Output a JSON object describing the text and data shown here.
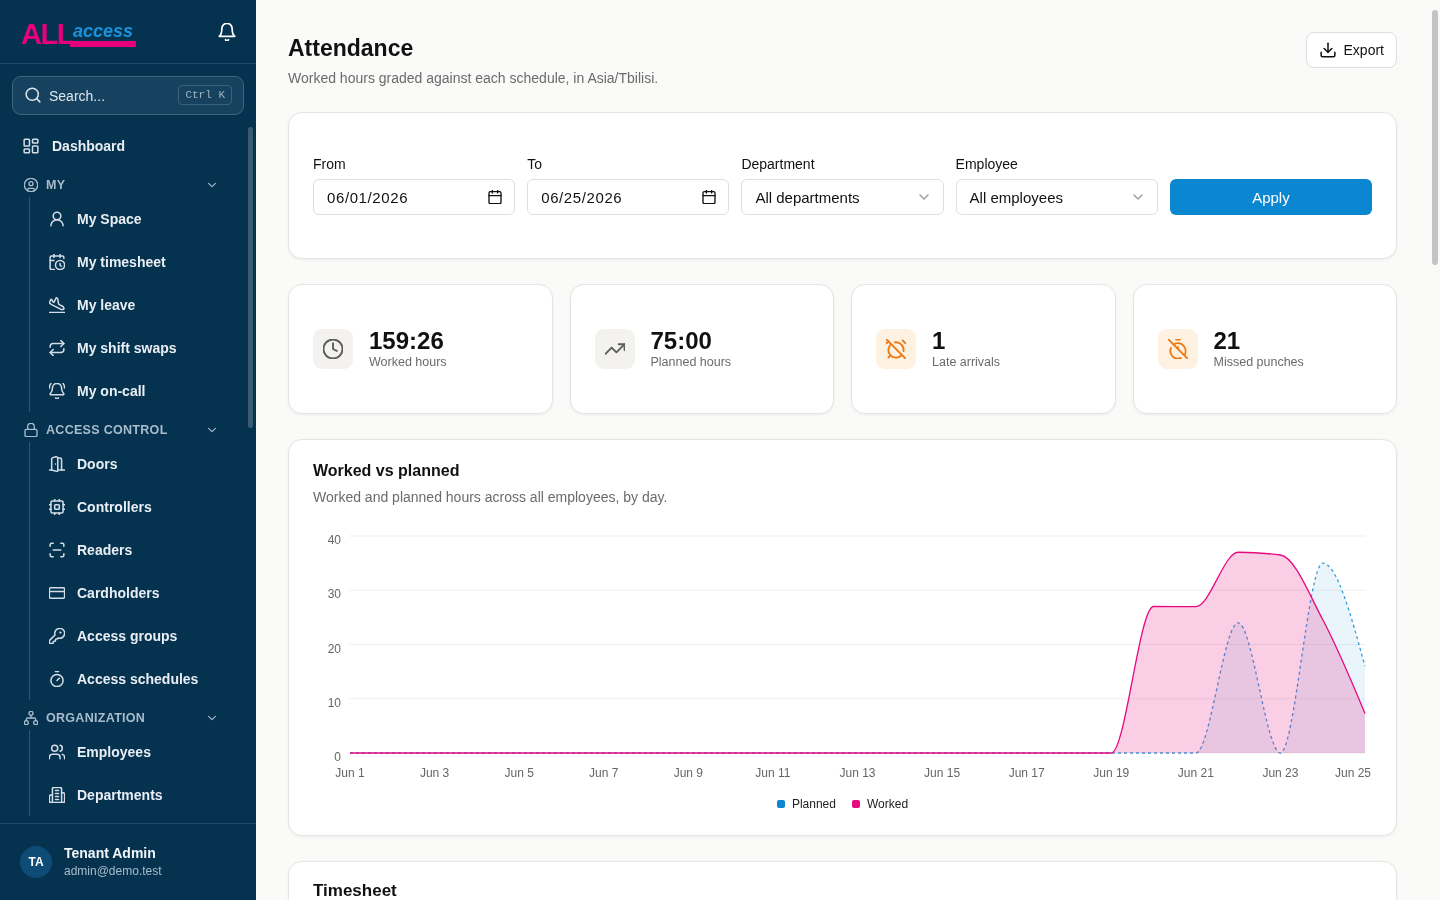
{
  "sidebar": {
    "logo": {
      "mark": "ALL",
      "word": "access"
    },
    "search": {
      "placeholder": "Search...",
      "shortcut": "Ctrl K"
    },
    "items": [
      {
        "kind": "link",
        "label": "Dashboard",
        "selected": false
      },
      {
        "kind": "section",
        "label": "MY",
        "expanded": true,
        "children": [
          {
            "label": "My Space",
            "selected": false
          },
          {
            "label": "My timesheet",
            "selected": false
          },
          {
            "label": "My leave",
            "selected": false
          },
          {
            "label": "My shift swaps",
            "selected": false
          },
          {
            "label": "My on-call",
            "selected": false
          }
        ]
      },
      {
        "kind": "section",
        "label": "ACCESS CONTROL",
        "expanded": true,
        "children": [
          {
            "label": "Doors",
            "selected": false
          },
          {
            "label": "Controllers",
            "selected": false
          },
          {
            "label": "Readers",
            "selected": false
          },
          {
            "label": "Cardholders",
            "selected": false
          },
          {
            "label": "Access groups",
            "selected": false
          },
          {
            "label": "Access schedules",
            "selected": false
          }
        ]
      },
      {
        "kind": "section",
        "label": "ORGANIZATION",
        "expanded": true,
        "children": [
          {
            "label": "Employees",
            "selected": false
          },
          {
            "label": "Departments",
            "selected": false
          }
        ]
      }
    ],
    "user": {
      "initials": "TA",
      "name": "Tenant Admin",
      "email": "admin@demo.test"
    }
  },
  "page": {
    "title": "Attendance",
    "subtitle": "Worked hours graded against each schedule, in Asia/Tbilisi.",
    "export_button": "Export"
  },
  "filters": {
    "fields": [
      {
        "kind": "date",
        "label": "From",
        "value": "06/01/2026"
      },
      {
        "kind": "date",
        "label": "To",
        "value": "06/25/2026"
      },
      {
        "kind": "select",
        "label": "Department",
        "value": "All departments"
      },
      {
        "kind": "select",
        "label": "Employee",
        "value": "All employees"
      }
    ],
    "apply_button": "Apply"
  },
  "stats": [
    {
      "value": "159:26",
      "label": "Worked hours",
      "warning": false
    },
    {
      "value": "75:00",
      "label": "Planned hours",
      "warning": false
    },
    {
      "value": "1",
      "label": "Late arrivals",
      "warning": true
    },
    {
      "value": "21",
      "label": "Missed punches",
      "warning": true
    }
  ],
  "chart_card": {
    "description": "Worked and planned hours across all employees, by day.",
    "chart_data": {
      "type": "area",
      "title": "Worked vs planned",
      "categories": [
        "Jun 1",
        null,
        "Jun 3",
        null,
        "Jun 5",
        null,
        "Jun 7",
        null,
        "Jun 9",
        null,
        "Jun 11",
        null,
        "Jun 13",
        null,
        "Jun 15",
        null,
        "Jun 17",
        null,
        "Jun 19",
        null,
        "Jun 21",
        null,
        "Jun 23",
        null,
        "Jun 25"
      ],
      "ylim": [
        0,
        40
      ],
      "yticks": [
        0,
        10,
        20,
        30,
        40
      ],
      "grid": true,
      "legend": "bottom",
      "series": [
        {
          "name": "Planned",
          "color": "#0b86d1",
          "values": [
            0,
            0,
            0,
            0,
            0,
            0,
            0,
            0,
            0,
            0,
            0,
            0,
            0,
            0,
            0,
            0,
            0,
            0,
            0,
            0,
            0,
            24,
            0,
            35,
            16
          ]
        },
        {
          "name": "Worked",
          "color": "#e6097f",
          "values": [
            0,
            0,
            0,
            0,
            0,
            0,
            0,
            0,
            0,
            0,
            0,
            0,
            0,
            0,
            0,
            0,
            0,
            0,
            0,
            27,
            27,
            37,
            36.5,
            24.6,
            7.3
          ]
        }
      ]
    }
  },
  "timesheet": {
    "title": "Timesheet"
  }
}
